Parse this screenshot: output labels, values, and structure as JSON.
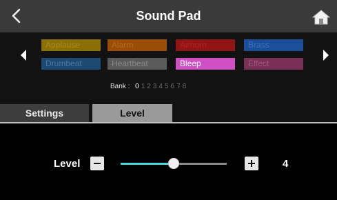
{
  "header": {
    "title": "Sound Pad",
    "back_icon": "back-chevron-icon",
    "home_icon": "home-icon"
  },
  "pads": [
    {
      "label": "Applause",
      "bg": "#8a6f06",
      "fg": "#a88c1c"
    },
    {
      "label": "Alarm",
      "bg": "#9a4d07",
      "fg": "#b86a1a"
    },
    {
      "label": "Airhorn",
      "bg": "#901515",
      "fg": "#b42020"
    },
    {
      "label": "Brass",
      "bg": "#1c4f9a",
      "fg": "#3a70be"
    },
    {
      "label": "Drumbeat",
      "bg": "#1d4a73",
      "fg": "#4a78a4"
    },
    {
      "label": "Heartbeat",
      "bg": "#5a5a5a",
      "fg": "#8a8a8a"
    },
    {
      "label": "Bleep",
      "bg": "#d04fc3",
      "fg": "#ffffff"
    },
    {
      "label": "Effect",
      "bg": "#7a2f57",
      "fg": "#a3577f"
    }
  ],
  "bank": {
    "label": "Bank :",
    "numbers": [
      "0",
      "1",
      "2",
      "3",
      "4",
      "5",
      "6",
      "7",
      "8"
    ],
    "selected": 0
  },
  "tabs": {
    "settings": "Settings",
    "level": "Level",
    "active": "level"
  },
  "level": {
    "label": "Level",
    "value": "4",
    "min": 0,
    "max": 8,
    "position": 4,
    "accent": "#45d8df"
  }
}
